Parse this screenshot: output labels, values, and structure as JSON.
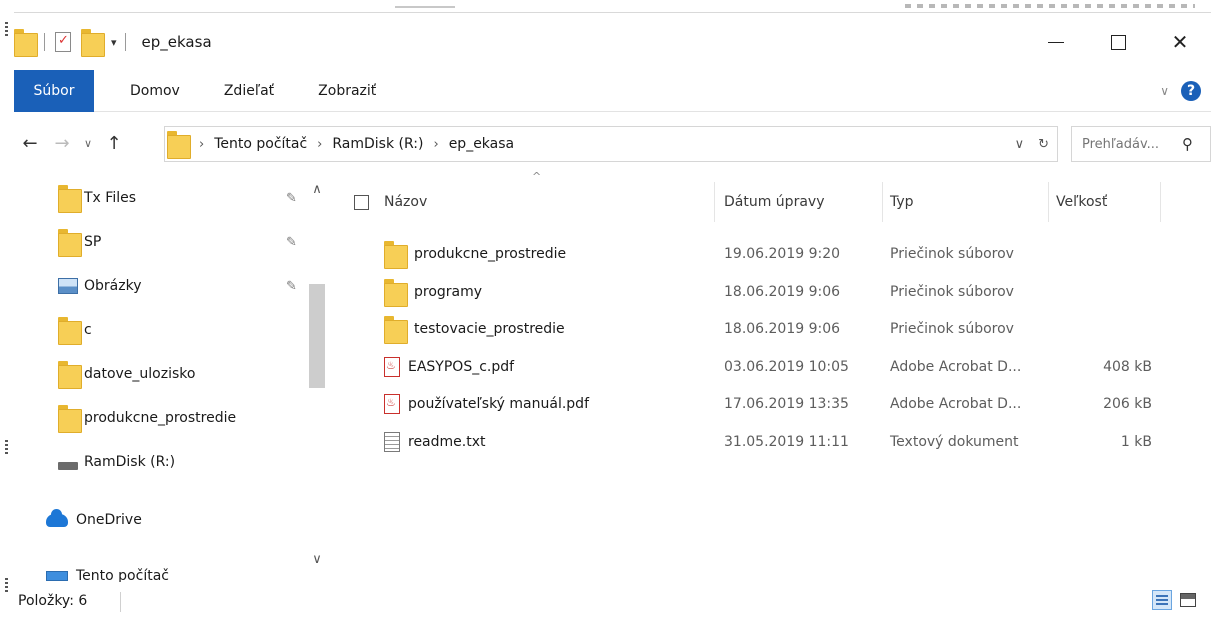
{
  "window": {
    "title": "ep_ekasa",
    "min_label": "—",
    "close_label": "✕"
  },
  "ribbon": {
    "file_tab": "Súbor",
    "tabs": [
      "Domov",
      "Zdieľať",
      "Zobraziť"
    ]
  },
  "address": {
    "crumbs": [
      "Tento počítač",
      "RamDisk (R:)",
      "ep_ekasa"
    ],
    "search_placeholder": "Prehľadáv..."
  },
  "nav_pane": {
    "items": [
      {
        "label": "Tx Files",
        "icon": "folder-icon",
        "pinned": true
      },
      {
        "label": "SP",
        "icon": "folder-icon",
        "pinned": true
      },
      {
        "label": "Obrázky",
        "icon": "pictures-icon",
        "pinned": true
      },
      {
        "label": "c",
        "icon": "folder-icon",
        "pinned": false
      },
      {
        "label": "datove_ulozisko",
        "icon": "folder-icon",
        "pinned": false
      },
      {
        "label": "produkcne_prostredie",
        "icon": "folder-icon",
        "pinned": false
      },
      {
        "label": "RamDisk (R:)",
        "icon": "drive-icon",
        "pinned": false
      },
      {
        "label": "OneDrive",
        "icon": "onedrive-icon",
        "pinned": false
      },
      {
        "label": "Tento počítač",
        "icon": "this-pc-icon",
        "pinned": false
      }
    ]
  },
  "file_list": {
    "columns": [
      "Názov",
      "Dátum úpravy",
      "Typ",
      "Veľkosť"
    ],
    "rows": [
      {
        "name": "produkcne_prostredie",
        "date": "19.06.2019 9:20",
        "type": "Priečinok súborov",
        "size": "",
        "icon": "folder-icon"
      },
      {
        "name": "programy",
        "date": "18.06.2019 9:06",
        "type": "Priečinok súborov",
        "size": "",
        "icon": "folder-icon"
      },
      {
        "name": "testovacie_prostredie",
        "date": "18.06.2019 9:06",
        "type": "Priečinok súborov",
        "size": "",
        "icon": "folder-icon"
      },
      {
        "name": "EASYPOS_c.pdf",
        "date": "03.06.2019 10:05",
        "type": "Adobe Acrobat D...",
        "size": "408 kB",
        "icon": "pdf-icon"
      },
      {
        "name": "používateľský manuál.pdf",
        "date": "17.06.2019 13:35",
        "type": "Adobe Acrobat D...",
        "size": "206 kB",
        "icon": "pdf-icon"
      },
      {
        "name": "readme.txt",
        "date": "31.05.2019 11:11",
        "type": "Textový dokument",
        "size": "1 kB",
        "icon": "text-file-icon"
      }
    ]
  },
  "status": {
    "items_count": "Položky: 6"
  },
  "colors": {
    "accent": "#1a60b8",
    "folder": "#f7cf56",
    "pdf": "#c9302c"
  }
}
